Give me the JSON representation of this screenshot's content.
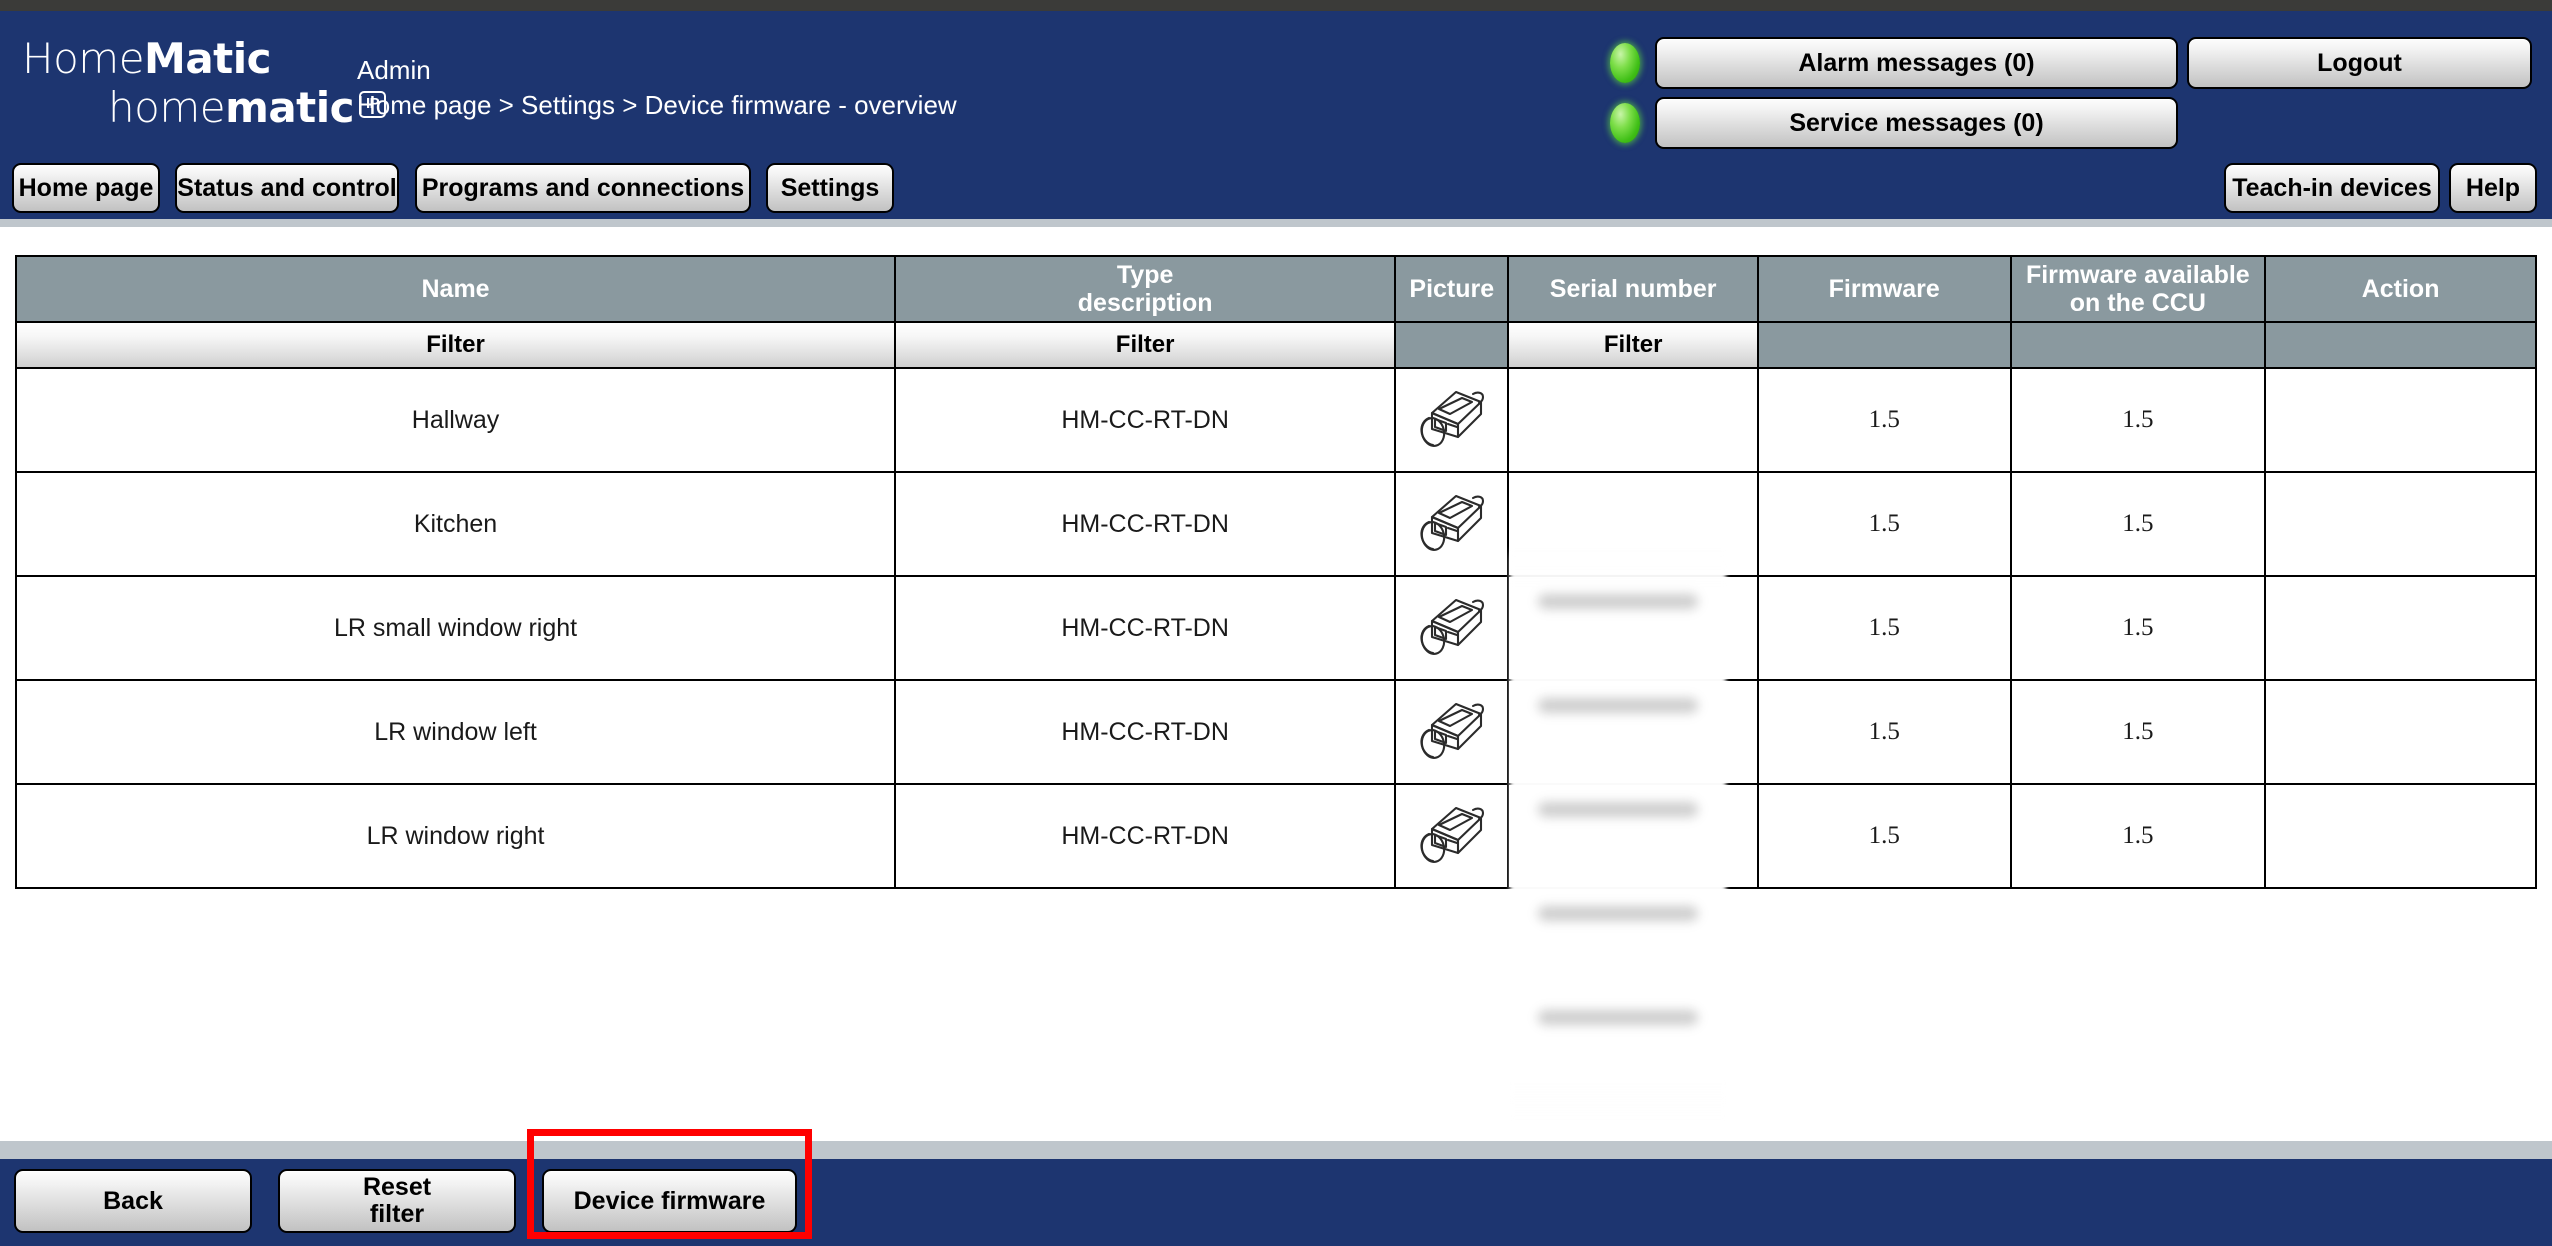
{
  "brand": {
    "logo_line1_light": "Home",
    "logo_line1_bold": "Matic",
    "logo_line2_light": "home",
    "logo_line2_bold": "matic",
    "logo_badge": "IP",
    "navy": "#1d3570",
    "header_gray": "#8a999f",
    "highlight_red": "#ff0000",
    "led_green": "#3fbf16"
  },
  "header": {
    "user": "Admin",
    "breadcrumb": "Home page > Settings > Device firmware - overview",
    "alarm_messages_label": "Alarm messages (0)",
    "service_messages_label": "Service messages (0)",
    "logout_label": "Logout",
    "teach_in_devices_label": "Teach-in devices",
    "help_label": "Help"
  },
  "nav": {
    "items": [
      {
        "label": "Home page"
      },
      {
        "label": "Status and control"
      },
      {
        "label": "Programs and connections"
      },
      {
        "label": "Settings"
      }
    ]
  },
  "table": {
    "columns": [
      {
        "label": "Name",
        "label_line2": ""
      },
      {
        "label": "Type",
        "label_line2": "description"
      },
      {
        "label": "Picture",
        "label_line2": ""
      },
      {
        "label": "Serial number",
        "label_line2": ""
      },
      {
        "label": "Firmware",
        "label_line2": ""
      },
      {
        "label": "Firmware available",
        "label_line2": "on the CCU"
      },
      {
        "label": "Action",
        "label_line2": ""
      }
    ],
    "filter_label": "Filter",
    "filters": {
      "name": "Filter",
      "type": "Filter",
      "serial": "Filter"
    },
    "rows": [
      {
        "name": "Hallway",
        "type_description": "HM-CC-RT-DN",
        "picture": "radiator-thermostat-icon",
        "serial_number": "",
        "firmware": "1.5",
        "firmware_available": "1.5",
        "action": ""
      },
      {
        "name": "Kitchen",
        "type_description": "HM-CC-RT-DN",
        "picture": "radiator-thermostat-icon",
        "serial_number": "",
        "firmware": "1.5",
        "firmware_available": "1.5",
        "action": ""
      },
      {
        "name": "LR small window right",
        "type_description": "HM-CC-RT-DN",
        "picture": "radiator-thermostat-icon",
        "serial_number": "",
        "firmware": "1.5",
        "firmware_available": "1.5",
        "action": ""
      },
      {
        "name": "LR window left",
        "type_description": "HM-CC-RT-DN",
        "picture": "radiator-thermostat-icon",
        "serial_number": "",
        "firmware": "1.5",
        "firmware_available": "1.5",
        "action": ""
      },
      {
        "name": "LR window right",
        "type_description": "HM-CC-RT-DN",
        "picture": "radiator-thermostat-icon",
        "serial_number": "",
        "firmware": "1.5",
        "firmware_available": "1.5",
        "action": ""
      }
    ]
  },
  "footer": {
    "back_label": "Back",
    "reset_filter_line1": "Reset",
    "reset_filter_line2": "filter",
    "device_firmware_label": "Device firmware"
  }
}
